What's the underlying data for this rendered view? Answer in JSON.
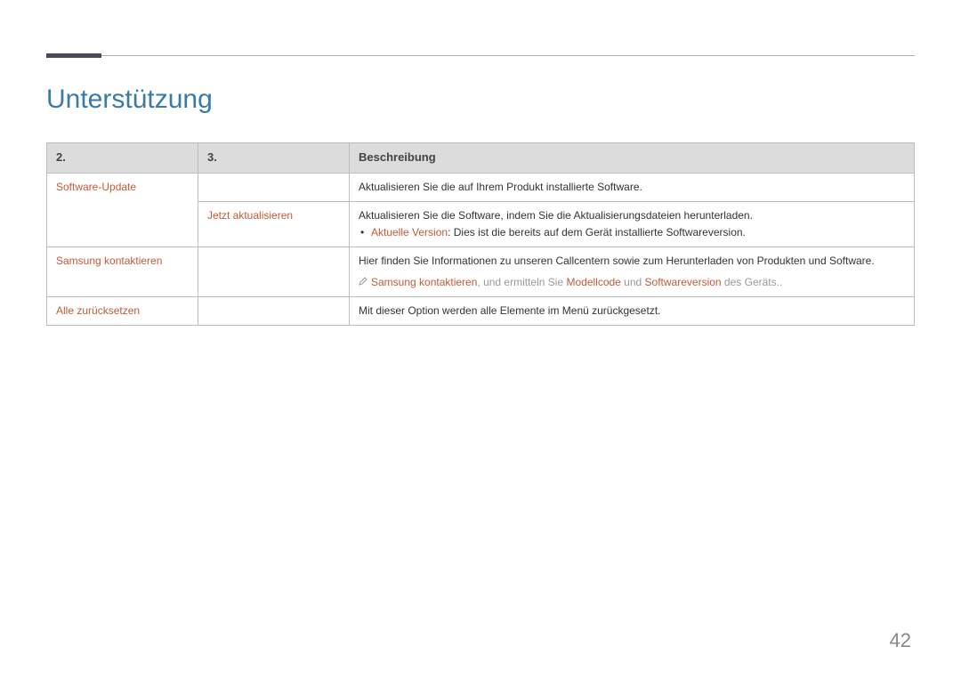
{
  "title": "Unterstützung",
  "pageNumber": "42",
  "headers": {
    "c1": "2.",
    "c2": "3.",
    "c3": "Beschreibung"
  },
  "rows": {
    "r1": {
      "c1": "Software-Update",
      "c3": "Aktualisieren Sie die auf Ihrem Produkt installierte Software."
    },
    "r2": {
      "c2": "Jetzt aktualisieren",
      "c3": "Aktualisieren Sie die Software, indem Sie die Aktualisierungsdateien herunterladen.",
      "bullet_label": "Aktuelle Version",
      "bullet_rest": ": Dies ist die bereits auf dem Gerät installierte Softwareversion."
    },
    "r3": {
      "c1": "Samsung kontaktieren",
      "c3": "Hier finden Sie Informationen zu unseren Callcentern sowie zum Herunterladen von Produkten und Software.",
      "note_a1": "Samsung kontaktieren",
      "note_m1": ", und ermitteln Sie ",
      "note_a2": "Modellcode",
      "note_m2": " und ",
      "note_a3": "Softwareversion",
      "note_m3": " des Geräts.."
    },
    "r4": {
      "c1": "Alle zurücksetzen",
      "c3": "Mit dieser Option werden alle Elemente im Menü zurückgesetzt."
    }
  }
}
